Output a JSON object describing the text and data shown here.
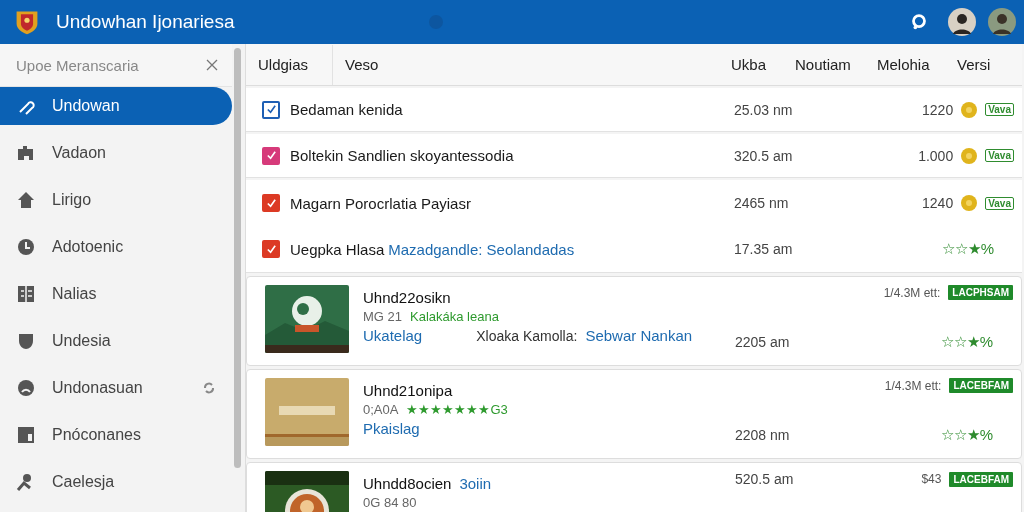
{
  "app_bar": {
    "title": "Undowhan Ijonariesa"
  },
  "sidebar": {
    "search": {
      "placeholder": "Upoe Meranscaria"
    },
    "items": [
      {
        "label": "Undowan",
        "selected": true
      },
      {
        "label": "Vadaon",
        "selected": false
      },
      {
        "label": "Lirigo",
        "selected": false
      },
      {
        "label": "Adotoenic",
        "selected": false
      },
      {
        "label": "Nalias",
        "selected": false
      },
      {
        "label": "Undesia",
        "selected": false
      },
      {
        "label": "Undonasuan",
        "selected": false,
        "extra": true
      },
      {
        "label": "Pnóconanes",
        "selected": false
      },
      {
        "label": "Caelesja",
        "selected": false
      }
    ]
  },
  "table": {
    "columns": [
      "Uldgias",
      "Veso",
      "Ukba",
      "Noutiam",
      "Melohia",
      "Versi"
    ],
    "rows": [
      {
        "kind": "task",
        "checked": true,
        "color": "#1e5fb4",
        "name": "Bedaman kenida",
        "time": "25.03 nm",
        "count": "1220",
        "badge": "Vava"
      },
      {
        "kind": "task",
        "checked": true,
        "color": "#d63a7a",
        "name": "Boltekin Sandlien skoyantessodia",
        "time": "320.5 am",
        "count": "1.000",
        "badge": "Vava"
      },
      {
        "kind": "task",
        "checked": true,
        "color": "#dc3a24",
        "name": "Magarn Porocrlatia Payiasr",
        "time": "2465 nm",
        "count": "1240",
        "badge": "Vava"
      },
      {
        "kind": "task",
        "checked": true,
        "color": "#dc3a24",
        "name": "Uegpka Hlasa",
        "link": "Mazadgandle:  Seolandadas",
        "time": "17.35 am",
        "rating": "☆☆★%"
      },
      {
        "kind": "app",
        "title": "Uhnd22osikn",
        "meta": "MG 21",
        "meta_green": "Kalakáka leana",
        "link": "Ukatelag",
        "label": "Xloaka Kamolla:",
        "link2": "Sebwar Nankan",
        "price": "1/4.3M ett:",
        "badge": "LACPHSAM",
        "time": "2205 am",
        "rating": "☆☆★%"
      },
      {
        "kind": "app",
        "title": "Uhnd21onipa",
        "meta": "0;A0A",
        "meta_green": "★★★★★★★G3",
        "link": "Pkaislag",
        "price": "1/4.3M ett:",
        "badge": "LACEBFAM",
        "time": "2208 nm",
        "rating": "☆☆★%"
      },
      {
        "kind": "app",
        "title": "Uhndd8ocien",
        "title_link": "3oiin",
        "meta": "0G 84 80",
        "price": "$43",
        "badge": "LACEBFAM",
        "time": "520.5 am"
      }
    ]
  }
}
